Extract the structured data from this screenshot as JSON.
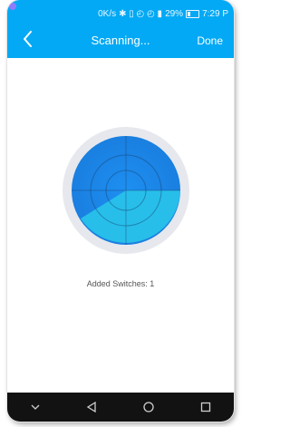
{
  "status_bar": {
    "speed": "0K/s",
    "signal": "29%",
    "time": "7:29 P"
  },
  "nav": {
    "title": "Scanning...",
    "done_label": "Done",
    "back_icon": "chevron-left-icon"
  },
  "status": {
    "added_switches_text": "Added Switches:  1"
  },
  "colors": {
    "accent": "#03a9f4",
    "radar_outer_ring": "#e6e8ee",
    "radar_dark": "#1b88e8",
    "radar_light": "#28c1ea",
    "system_nav": "#121212"
  },
  "system_nav": {
    "icons": [
      "chevron-down-icon",
      "back-triangle-icon",
      "home-circle-icon",
      "recents-square-icon"
    ]
  }
}
